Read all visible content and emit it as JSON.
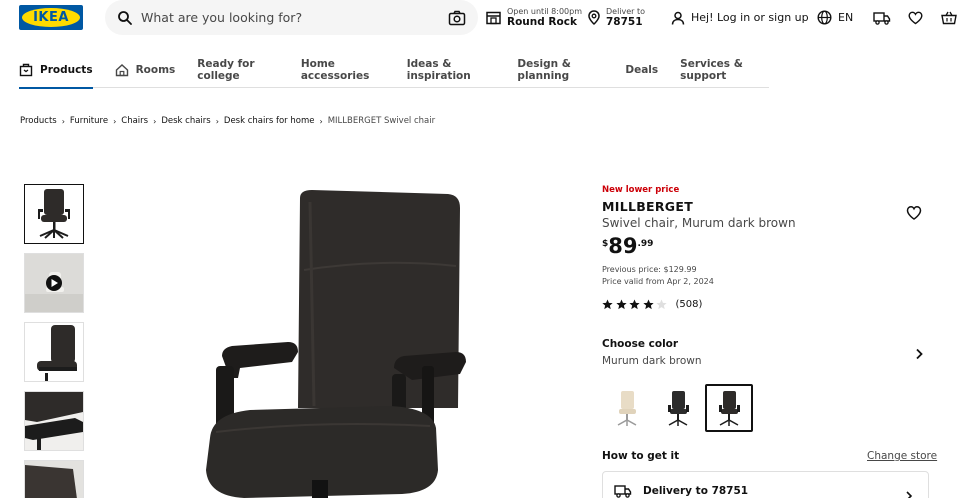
{
  "brand": {
    "logo_text": "IKEA",
    "blue": "#0058a3",
    "yellow": "#ffdb00"
  },
  "search": {
    "placeholder": "What are you looking for?"
  },
  "header": {
    "store": {
      "small": "Open until 8:00pm",
      "big": "Round Rock"
    },
    "deliver": {
      "small": "Deliver to",
      "big": "78751"
    },
    "login": "Hej! Log in or sign up",
    "language": "EN",
    "icons": [
      "store-icon",
      "location-pin-icon",
      "person-icon",
      "globe-icon",
      "truck-icon",
      "heart-icon",
      "cart-icon"
    ]
  },
  "nav": {
    "items": [
      {
        "label": "Products",
        "active": true
      },
      {
        "label": "Rooms"
      },
      {
        "label": "Ready for college"
      },
      {
        "label": "Home accessories"
      },
      {
        "label": "Ideas & inspiration"
      },
      {
        "label": "Design & planning"
      },
      {
        "label": "Deals"
      },
      {
        "label": "Services & support"
      }
    ]
  },
  "breadcrumb": [
    "Products",
    "Furniture",
    "Chairs",
    "Desk chairs",
    "Desk chairs for home",
    "MILLBERGET Swivel chair"
  ],
  "product": {
    "badge": "New lower price",
    "name": "MILLBERGET",
    "description": "Swivel chair, Murum dark brown",
    "price": {
      "currency": "$",
      "integer": "89",
      "decimal": ".99"
    },
    "previous_price": "Previous price: $129.99",
    "price_valid": "Price valid from Apr 2, 2024",
    "rating": {
      "stars": 4,
      "max": 5,
      "reviews": "(508)"
    },
    "choose_color": "Choose color",
    "color_name": "Murum dark brown",
    "swatches": [
      {
        "name": "white-beige",
        "color": "#e8dcc6"
      },
      {
        "name": "black",
        "color": "#2b2b2b"
      },
      {
        "name": "dark-brown",
        "color": "#2e2b29",
        "selected": true
      }
    ],
    "how_to_get": "How to get it",
    "change_store": "Change store",
    "delivery": "Delivery to 78751"
  },
  "colors": {
    "badge_red": "#cc0008",
    "text": "#111111",
    "muted": "#484848"
  }
}
